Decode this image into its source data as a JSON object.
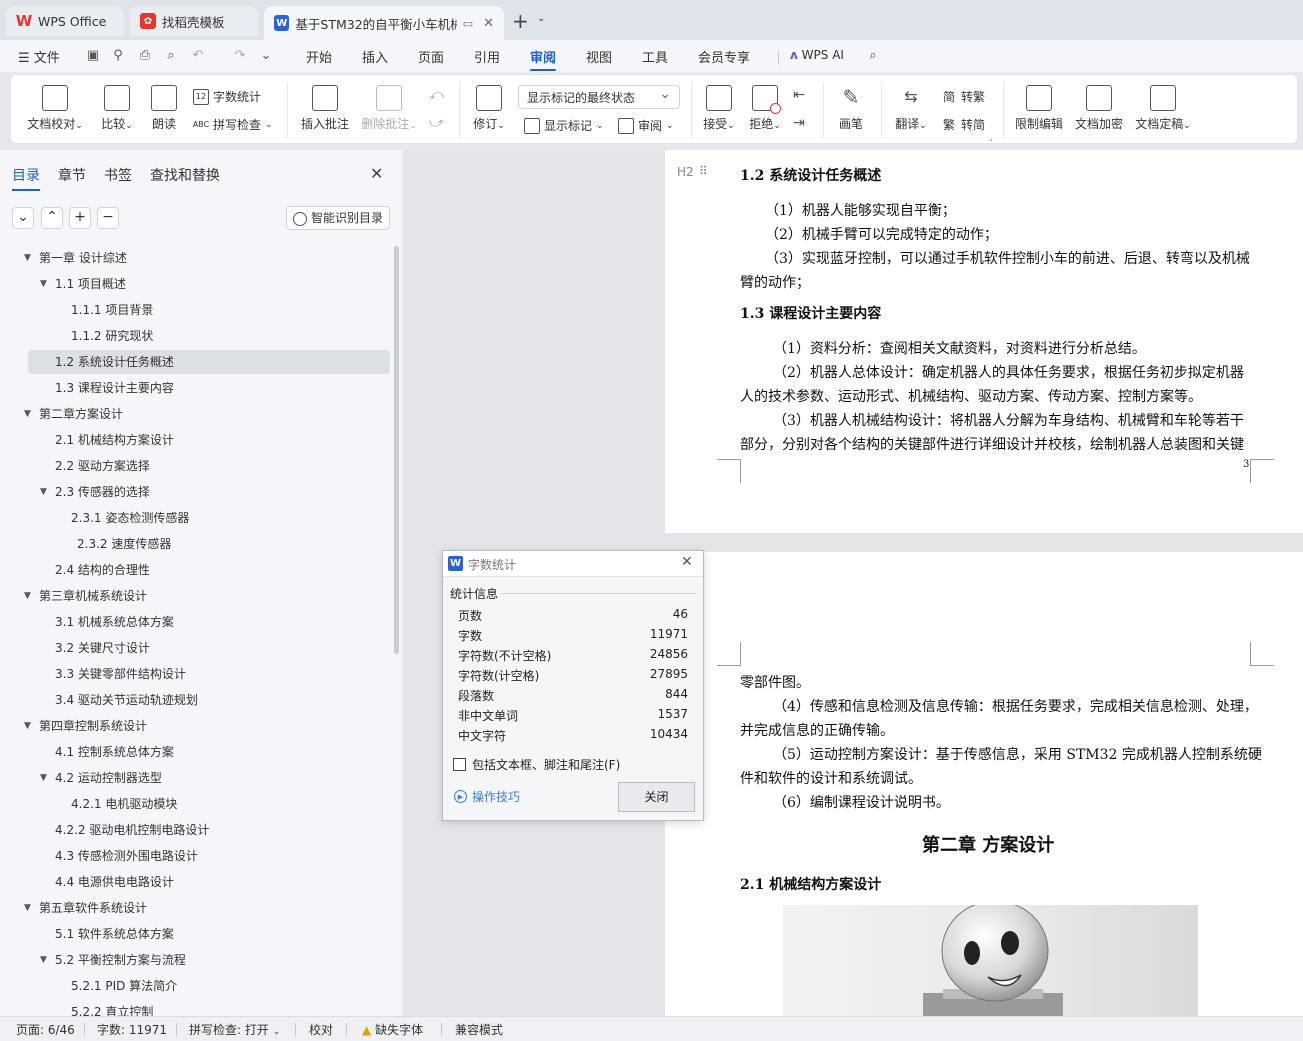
{
  "tabs": [
    {
      "label": "WPS Office",
      "icon": "wps-logo-icon"
    },
    {
      "label": "找稻壳模板",
      "icon": "docer-logo-icon"
    },
    {
      "label": "基于STM32的自平衡小车机械",
      "icon": "wps-writer-icon"
    }
  ],
  "menubar": {
    "file": "文件",
    "items": [
      "开始",
      "插入",
      "页面",
      "引用",
      "审阅",
      "视图",
      "工具",
      "会员专享"
    ],
    "active": "审阅",
    "ai": "WPS AI"
  },
  "ribbon": {
    "doc_proofread": "文档校对",
    "compare": "比较",
    "read_aloud": "朗读",
    "word_count": "字数统计",
    "spell_check": "拼写检查",
    "insert_comment": "插入批注",
    "delete_comment": "删除批注",
    "track_changes": "修订",
    "markup_state": "显示标记的最终状态",
    "show_markup": "显示标记",
    "review_pane": "审阅",
    "accept": "接受",
    "reject": "拒绝",
    "pen": "画笔",
    "translate": "翻译",
    "to_traditional": "转繁",
    "to_simplified": "转简",
    "restrict_edit": "限制编辑",
    "encrypt": "文档加密",
    "finalize": "文档定稿"
  },
  "nav": {
    "tabs": [
      "目录",
      "章节",
      "书签",
      "查找和替换"
    ],
    "smart_toc": "智能识别目录",
    "toc": [
      {
        "label": "第一章  设计综述",
        "level": 1,
        "expanded": true
      },
      {
        "label": "1.1  项目概述",
        "level": 2,
        "expanded": true
      },
      {
        "label": "1.1.1  项目背景",
        "level": 3
      },
      {
        "label": "1.1.2  研究现状",
        "level": 3
      },
      {
        "label": "1.2  系统设计任务概述",
        "level": 2,
        "selected": true
      },
      {
        "label": "1.3  课程设计主要内容",
        "level": 2
      },
      {
        "label": "第二章方案设计",
        "level": 1,
        "expanded": true
      },
      {
        "label": "2.1  机械结构方案设计",
        "level": 2
      },
      {
        "label": "2.2  驱动方案选择",
        "level": 2
      },
      {
        "label": "2.3  传感器的选择",
        "level": 2,
        "expanded": true
      },
      {
        "label": "2.3.1  姿态检测传感器",
        "level": 3
      },
      {
        "label": "2.3.2  速度传感器",
        "level": 3,
        "indent_extra": true
      },
      {
        "label": "2.4  结构的合理性",
        "level": 2
      },
      {
        "label": "第三章机械系统设计",
        "level": 1,
        "expanded": true
      },
      {
        "label": "3.1  机械系统总体方案",
        "level": 2
      },
      {
        "label": "3.2  关键尺寸设计",
        "level": 2
      },
      {
        "label": "3.3  关键零部件结构设计",
        "level": 2
      },
      {
        "label": "3.4  驱动关节运动轨迹规划",
        "level": 2
      },
      {
        "label": "第四章控制系统设计",
        "level": 1,
        "expanded": true
      },
      {
        "label": "4.1  控制系统总体方案",
        "level": 2
      },
      {
        "label": "4.2  运动控制器选型",
        "level": 2,
        "expanded": true
      },
      {
        "label": "4.2.1  电机驱动模块",
        "level": 3
      },
      {
        "label": "4.2.2  驱动电机控制电路设计",
        "level": 2
      },
      {
        "label": "4.3  传感检测外围电路设计",
        "level": 2
      },
      {
        "label": "4.4  电源供电电路设计",
        "level": 2
      },
      {
        "label": "第五章软件系统设计",
        "level": 1,
        "expanded": true
      },
      {
        "label": "5.1  软件系统总体方案",
        "level": 2
      },
      {
        "label": "5.2  平衡控制方案与流程",
        "level": 2,
        "expanded": true
      },
      {
        "label": "5.2.1 PID 算法简介",
        "level": 3
      },
      {
        "label": "5.2.2  直立控制",
        "level": 3
      }
    ]
  },
  "doc": {
    "heading_marker": "H2",
    "page1": {
      "h_1_2": "1.2  系统设计任务概述",
      "lines_a": [
        "（1）机器人能够实现自平衡；",
        "（2）机械手臂可以完成特定的动作；",
        "（3）实现蓝牙控制，可以通过手机软件控制小车的前进、后退、转弯以及机械",
        "臂的动作；"
      ],
      "h_1_3": "1.3  课程设计主要内容",
      "lines_b": [
        "（1）资料分析：查阅相关文献资料，对资料进行分析总结。",
        "（2）机器人总体设计：确定机器人的具体任务要求，根据任务初步拟定机器",
        "人的技术参数、运动形式、机械结构、驱动方案、传动方案、控制方案等。",
        "（3）机器人机械结构设计：将机器人分解为车身结构、机械臂和车轮等若干",
        "部分，分别对各个结构的关键部件进行详细设计并校核，绘制机器人总装图和关键"
      ],
      "page_number": "3"
    },
    "page2": {
      "lines": [
        "零部件图。",
        "（4）传感和信息检测及信息传输：根据任务要求，完成相关信息检测、处理，",
        "并完成信息的正确传输。",
        "（5）运动控制方案设计：基于传感信息，采用 STM32 完成机器人控制系统硬",
        "件和软件的设计和系统调试。",
        "（6）编制课程设计说明书。"
      ],
      "chapter": "第二章  方案设计",
      "h_2_1": "2.1  机械结构方案设计"
    }
  },
  "word_count": {
    "title": "字数统计",
    "section": "统计信息",
    "rows": [
      {
        "label": "页数",
        "value": "46"
      },
      {
        "label": "字数",
        "value": "11971"
      },
      {
        "label": "字符数(不计空格)",
        "value": "24856"
      },
      {
        "label": "字符数(计空格)",
        "value": "27895"
      },
      {
        "label": "段落数",
        "value": "844"
      },
      {
        "label": "非中文单词",
        "value": "1537"
      },
      {
        "label": "中文字符",
        "value": "10434"
      }
    ],
    "checkbox": "包括文本框、脚注和尾注(F)",
    "checkbox_checked": false,
    "tips": "操作技巧",
    "close": "关闭"
  },
  "status": {
    "page": "页面: 6/46",
    "words": "字数: 11971",
    "spell": "拼写检查: 打开",
    "proof": "校对",
    "missing_font": "缺失字体",
    "compat": "兼容模式"
  },
  "colors": {
    "accent": "#1f5fd6",
    "wps_red": "#e8352e"
  }
}
